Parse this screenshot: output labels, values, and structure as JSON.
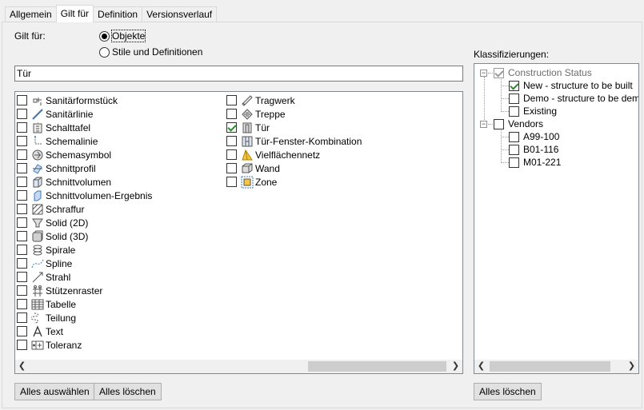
{
  "tabs": [
    {
      "label": "Allgemein"
    },
    {
      "label": "Gilt für"
    },
    {
      "label": "Definition"
    },
    {
      "label": "Versionsverlauf"
    }
  ],
  "applies_to": {
    "label": "Gilt für:",
    "options": [
      {
        "label": "Objekte",
        "selected": true
      },
      {
        "label": "Stile und Definitionen",
        "selected": false
      }
    ]
  },
  "filter": {
    "value": "Tür"
  },
  "objects": {
    "column1": [
      {
        "label": "Sanitärformstück",
        "icon": "sanitary-fitting-icon",
        "checked": false
      },
      {
        "label": "Sanitärlinie",
        "icon": "sanitary-line-icon",
        "checked": false
      },
      {
        "label": "Schalttafel",
        "icon": "panel-icon",
        "checked": false
      },
      {
        "label": "Schemalinie",
        "icon": "schematic-line-icon",
        "checked": false
      },
      {
        "label": "Schemasymbol",
        "icon": "schematic-symbol-icon",
        "checked": false
      },
      {
        "label": "Schnittprofil",
        "icon": "section-profile-icon",
        "checked": false
      },
      {
        "label": "Schnittvolumen",
        "icon": "section-volume-icon",
        "checked": false
      },
      {
        "label": "Schnittvolumen-Ergebnis",
        "icon": "section-volume-result-icon",
        "checked": false
      },
      {
        "label": "Schraffur",
        "icon": "hatch-icon",
        "checked": false
      },
      {
        "label": "Solid (2D)",
        "icon": "solid-2d-icon",
        "checked": false
      },
      {
        "label": "Solid (3D)",
        "icon": "solid-3d-icon",
        "checked": false
      },
      {
        "label": "Spirale",
        "icon": "helix-icon",
        "checked": false
      },
      {
        "label": "Spline",
        "icon": "spline-icon",
        "checked": false
      },
      {
        "label": "Strahl",
        "icon": "ray-icon",
        "checked": false
      },
      {
        "label": "Stützenraster",
        "icon": "column-grid-icon",
        "checked": false
      },
      {
        "label": "Tabelle",
        "icon": "table-icon",
        "checked": false
      },
      {
        "label": "Teilung",
        "icon": "division-icon",
        "checked": false
      },
      {
        "label": "Text",
        "icon": "text-icon",
        "checked": false
      },
      {
        "label": "Toleranz",
        "icon": "tolerance-icon",
        "checked": false
      }
    ],
    "column2": [
      {
        "label": "Tragwerk",
        "icon": "structural-member-icon",
        "checked": false
      },
      {
        "label": "Treppe",
        "icon": "stair-icon",
        "checked": false
      },
      {
        "label": "Tür",
        "icon": "door-icon",
        "checked": true
      },
      {
        "label": "Tür-Fenster-Kombination",
        "icon": "door-window-assembly-icon",
        "checked": false
      },
      {
        "label": "Vielflächennetz",
        "icon": "polyface-mesh-icon",
        "checked": false
      },
      {
        "label": "Wand",
        "icon": "wall-icon",
        "checked": false
      },
      {
        "label": "Zone",
        "icon": "zone-icon",
        "checked": false
      }
    ]
  },
  "buttons": {
    "select_all": "Alles auswählen",
    "clear_all": "Alles löschen",
    "clear_all_class": "Alles löschen"
  },
  "classifications": {
    "label": "Klassifizierungen:",
    "groups": [
      {
        "label": "Construction Status",
        "checked": true,
        "items": [
          {
            "label": "New - structure to be built",
            "checked": true
          },
          {
            "label": "Demo - structure to be demoli",
            "checked": false
          },
          {
            "label": "Existing",
            "checked": false
          }
        ]
      },
      {
        "label": "Vendors",
        "checked": false,
        "items": [
          {
            "label": "A99-100",
            "checked": false
          },
          {
            "label": "B01-116",
            "checked": false
          },
          {
            "label": "M01-221",
            "checked": false
          }
        ]
      }
    ]
  }
}
